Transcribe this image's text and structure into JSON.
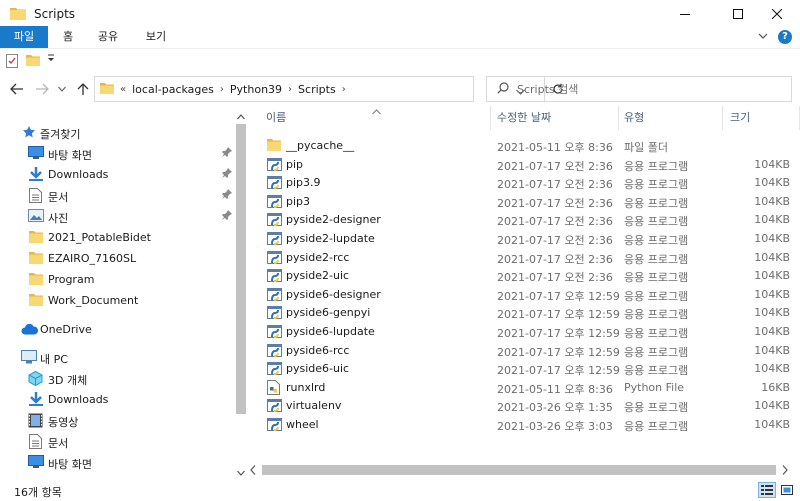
{
  "window": {
    "title": "Scripts"
  },
  "ribbon": {
    "tabs": [
      "파일",
      "홈",
      "공유",
      "보기"
    ]
  },
  "address": {
    "overflow": "«",
    "crumbs": [
      "local-packages",
      "Python39",
      "Scripts"
    ]
  },
  "search": {
    "placeholder": "Scripts 검색"
  },
  "nav": {
    "items": [
      {
        "label": "즐겨찾기",
        "icon": "star-icon",
        "indent": 0,
        "pinned": false
      },
      {
        "label": "바탕 화면",
        "icon": "desktop-icon",
        "indent": 1,
        "pinned": true
      },
      {
        "label": "Downloads",
        "icon": "download-icon",
        "indent": 1,
        "pinned": true
      },
      {
        "label": "문서",
        "icon": "document-icon",
        "indent": 1,
        "pinned": true
      },
      {
        "label": "사진",
        "icon": "picture-icon",
        "indent": 1,
        "pinned": true
      },
      {
        "label": "2021_PotableBidet",
        "icon": "folder-icon",
        "indent": 1,
        "pinned": false
      },
      {
        "label": "EZAIRO_7160SL",
        "icon": "folder-icon",
        "indent": 1,
        "pinned": false
      },
      {
        "label": "Program",
        "icon": "folder-icon",
        "indent": 1,
        "pinned": false
      },
      {
        "label": "Work_Document",
        "icon": "folder-icon",
        "indent": 1,
        "pinned": false
      },
      {
        "label": "OneDrive",
        "icon": "cloud-icon",
        "indent": 0,
        "pinned": false
      },
      {
        "label": "내 PC",
        "icon": "computer-icon",
        "indent": 0,
        "pinned": false
      },
      {
        "label": "3D 개체",
        "icon": "cube-icon",
        "indent": 1,
        "pinned": false
      },
      {
        "label": "Downloads",
        "icon": "download-icon",
        "indent": 1,
        "pinned": false
      },
      {
        "label": "동영상",
        "icon": "video-icon",
        "indent": 1,
        "pinned": false
      },
      {
        "label": "문서",
        "icon": "document-icon",
        "indent": 1,
        "pinned": false
      },
      {
        "label": "바탕 화면",
        "icon": "desktop-icon",
        "indent": 1,
        "pinned": false
      }
    ]
  },
  "columns": {
    "name": "이름",
    "date": "수정한 날짜",
    "type": "유형",
    "size": "크기"
  },
  "files": [
    {
      "name": "__pycache__",
      "date": "2021-05-11 오후 8:36",
      "type": "파일 폴더",
      "size": "",
      "icon": "folder-icon"
    },
    {
      "name": "pip",
      "date": "2021-07-17 오전 2:36",
      "type": "응용 프로그램",
      "size": "104KB",
      "icon": "python-exe-icon"
    },
    {
      "name": "pip3.9",
      "date": "2021-07-17 오전 2:36",
      "type": "응용 프로그램",
      "size": "104KB",
      "icon": "python-exe-icon"
    },
    {
      "name": "pip3",
      "date": "2021-07-17 오전 2:36",
      "type": "응용 프로그램",
      "size": "104KB",
      "icon": "python-exe-icon"
    },
    {
      "name": "pyside2-designer",
      "date": "2021-07-17 오전 2:36",
      "type": "응용 프로그램",
      "size": "104KB",
      "icon": "python-exe-icon"
    },
    {
      "name": "pyside2-lupdate",
      "date": "2021-07-17 오전 2:36",
      "type": "응용 프로그램",
      "size": "104KB",
      "icon": "python-exe-icon"
    },
    {
      "name": "pyside2-rcc",
      "date": "2021-07-17 오전 2:36",
      "type": "응용 프로그램",
      "size": "104KB",
      "icon": "python-exe-icon"
    },
    {
      "name": "pyside2-uic",
      "date": "2021-07-17 오전 2:36",
      "type": "응용 프로그램",
      "size": "104KB",
      "icon": "python-exe-icon"
    },
    {
      "name": "pyside6-designer",
      "date": "2021-07-17 오후 12:59",
      "type": "응용 프로그램",
      "size": "104KB",
      "icon": "python-exe-icon"
    },
    {
      "name": "pyside6-genpyi",
      "date": "2021-07-17 오후 12:59",
      "type": "응용 프로그램",
      "size": "104KB",
      "icon": "python-exe-icon"
    },
    {
      "name": "pyside6-lupdate",
      "date": "2021-07-17 오후 12:59",
      "type": "응용 프로그램",
      "size": "104KB",
      "icon": "python-exe-icon"
    },
    {
      "name": "pyside6-rcc",
      "date": "2021-07-17 오후 12:59",
      "type": "응용 프로그램",
      "size": "104KB",
      "icon": "python-exe-icon"
    },
    {
      "name": "pyside6-uic",
      "date": "2021-07-17 오후 12:59",
      "type": "응용 프로그램",
      "size": "104KB",
      "icon": "python-exe-icon"
    },
    {
      "name": "runxlrd",
      "date": "2021-05-11 오후 8:36",
      "type": "Python File",
      "size": "16KB",
      "icon": "python-file-icon"
    },
    {
      "name": "virtualenv",
      "date": "2021-03-26 오후 1:35",
      "type": "응용 프로그램",
      "size": "104KB",
      "icon": "python-exe-icon"
    },
    {
      "name": "wheel",
      "date": "2021-03-26 오후 3:03",
      "type": "응용 프로그램",
      "size": "104KB",
      "icon": "python-exe-icon"
    }
  ],
  "status": {
    "count": "16개 항목"
  },
  "colors": {
    "accent": "#1979ca",
    "folder": "#f8d775",
    "header_text": "#4c607a"
  }
}
